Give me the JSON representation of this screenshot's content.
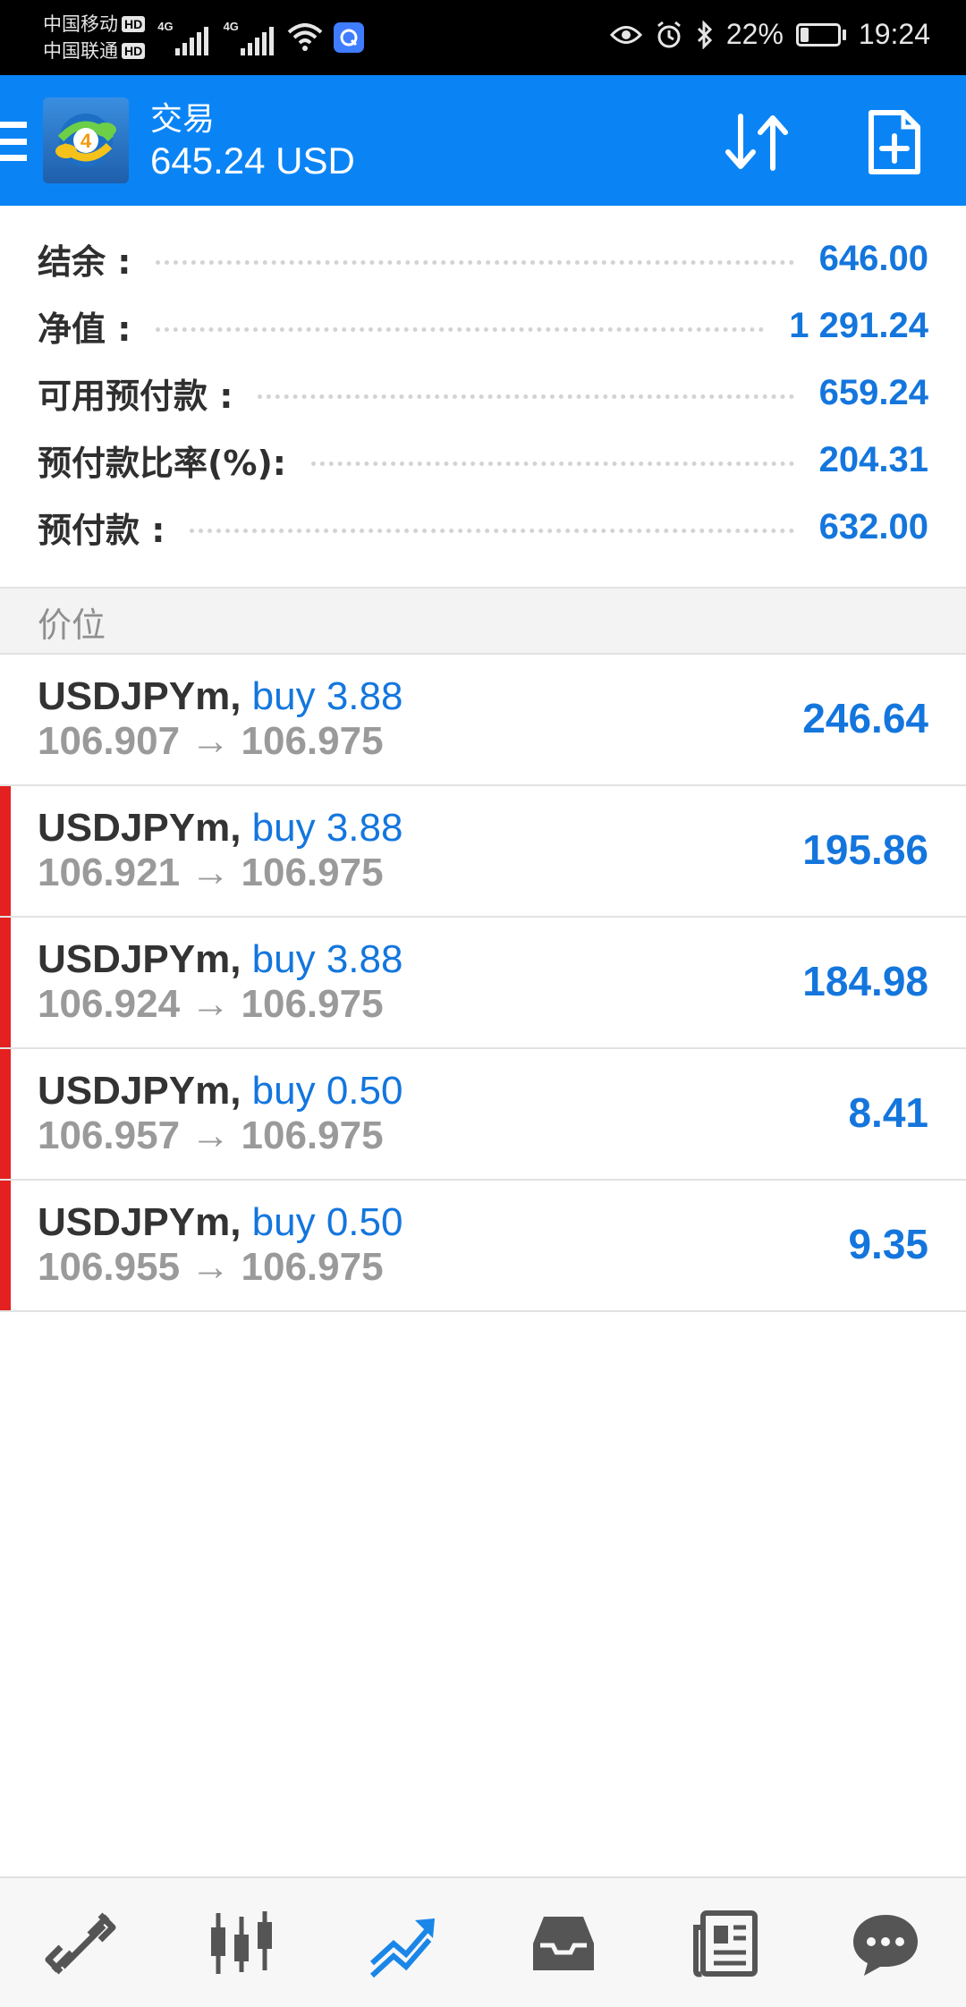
{
  "status_bar": {
    "carrier1": "中国移动",
    "carrier2": "中国联通",
    "hd_badge": "HD",
    "network1": "4G",
    "network2": "4G",
    "battery_percent": "22%",
    "battery_level": 0.22,
    "time": "19:24"
  },
  "header": {
    "title": "交易",
    "subtitle": "645.24 USD",
    "logo_number": "4"
  },
  "summary": [
    {
      "label": "结余 :",
      "value": "646.00"
    },
    {
      "label": "净值 :",
      "value": "1 291.24"
    },
    {
      "label": "可用预付款 :",
      "value": "659.24"
    },
    {
      "label": "预付款比率(%):",
      "value": "204.31"
    },
    {
      "label": "预付款 :",
      "value": "632.00"
    }
  ],
  "section_title": "价位",
  "positions": [
    {
      "symbol": "USDJPYm,",
      "side": "buy 3.88",
      "prices": "106.907 → 106.975",
      "profit": "246.64",
      "marker": false
    },
    {
      "symbol": "USDJPYm,",
      "side": "buy 3.88",
      "prices": "106.921 → 106.975",
      "profit": "195.86",
      "marker": true
    },
    {
      "symbol": "USDJPYm,",
      "side": "buy 3.88",
      "prices": "106.924 → 106.975",
      "profit": "184.98",
      "marker": true
    },
    {
      "symbol": "USDJPYm,",
      "side": "buy 0.50",
      "prices": "106.957 → 106.975",
      "profit": "8.41",
      "marker": true
    },
    {
      "symbol": "USDJPYm,",
      "side": "buy 0.50",
      "prices": "106.955 → 106.975",
      "profit": "9.35",
      "marker": true
    }
  ],
  "bottom_nav": [
    {
      "name": "quotes-icon",
      "active": false
    },
    {
      "name": "chart-icon",
      "active": false
    },
    {
      "name": "trade-icon",
      "active": true
    },
    {
      "name": "history-icon",
      "active": false
    },
    {
      "name": "news-icon",
      "active": false
    },
    {
      "name": "chat-icon",
      "active": false
    }
  ],
  "colors": {
    "header_bg": "#0a84f5",
    "accent_blue": "#1476dd",
    "marker_red": "#e52020",
    "muted_gray": "#9a9a9a"
  }
}
